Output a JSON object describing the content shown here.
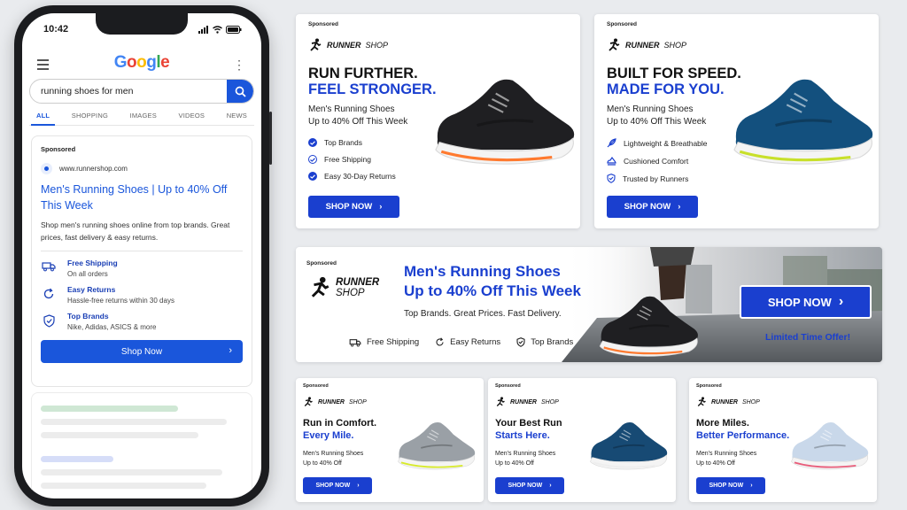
{
  "phone": {
    "time": "10:42",
    "logo": "Google",
    "search": {
      "query": "running shoes for men"
    },
    "tabs": [
      "ALL",
      "SHOPPING",
      "IMAGES",
      "VIDEOS",
      "NEWS"
    ],
    "ad": {
      "sponsored": "Sponsored",
      "url": "www.runnershop.com",
      "title": "Men's Running Shoes | Up to 40% Off This Week",
      "description": "Shop men's running shoes online from top brands. Great prices, fast delivery & easy returns.",
      "features": [
        {
          "title": "Free Shipping",
          "detail": "On all orders",
          "icon": "truck-icon"
        },
        {
          "title": "Easy Returns",
          "detail": "Hassle-free returns within 30 days",
          "icon": "refresh-icon"
        },
        {
          "title": "Top Brands",
          "detail": "Nike, Adidas, ASICS & more",
          "icon": "shield-check-icon"
        }
      ],
      "cta": "Shop Now"
    }
  },
  "banners": {
    "b1": {
      "sponsored": "Sponsored",
      "brand_a": "RUNNER",
      "brand_b": "SHOP",
      "line1": "RUN FURTHER.",
      "line2": "FEEL STRONGER.",
      "sub1": "Men's Running Shoes",
      "sub2": "Up to 40% Off This Week",
      "list": [
        "Top Brands",
        "Free Shipping",
        "Easy 30-Day Returns"
      ],
      "cta": "SHOP NOW"
    },
    "b2": {
      "sponsored": "Sponsored",
      "brand_a": "RUNNER",
      "brand_b": "SHOP",
      "line1": "BUILT FOR SPEED.",
      "line2": "MADE FOR YOU.",
      "sub1": "Men's Running Shoes",
      "sub2": "Up to 40% Off This Week",
      "list": [
        "Lightweight & Breathable",
        "Cushioned Comfort",
        "Trusted by Runners"
      ],
      "cta": "SHOP NOW"
    },
    "wide": {
      "sponsored": "Sponsored",
      "brand_a": "RUNNER",
      "brand_b": "SHOP",
      "line1": "Men's Running Shoes",
      "line2": "Up to 40% Off This Week",
      "sub": "Top Brands. Great Prices. Fast Delivery.",
      "feats": [
        "Free Shipping",
        "Easy Returns",
        "Top Brands"
      ],
      "cta": "SHOP NOW",
      "limited": "Limited Time Offer!"
    },
    "s1": {
      "sponsored": "Sponsored",
      "brand_a": "RUNNER",
      "brand_b": "SHOP",
      "line1": "Run in Comfort.",
      "line2": "Every Mile.",
      "sub1": "Men's Running Shoes",
      "sub2": "Up to 40% Off",
      "cta": "SHOP NOW"
    },
    "s2": {
      "sponsored": "Sponsored",
      "brand_a": "RUNNER",
      "brand_b": "SHOP",
      "line1": "Your Best Run",
      "line2": "Starts Here.",
      "sub1": "Men's Running Shoes",
      "sub2": "Up to 40% Off",
      "cta": "SHOP NOW"
    },
    "s3": {
      "sponsored": "Sponsored",
      "brand_a": "RUNNER",
      "brand_b": "SHOP",
      "line1": "More Miles.",
      "line2": "Better Performance.",
      "sub1": "Men's Running Shoes",
      "sub2": "Up to 40% Off",
      "cta": "SHOP NOW"
    }
  },
  "colors": {
    "accent": "#1a56db",
    "brand_blue": "#1a3fcf"
  }
}
